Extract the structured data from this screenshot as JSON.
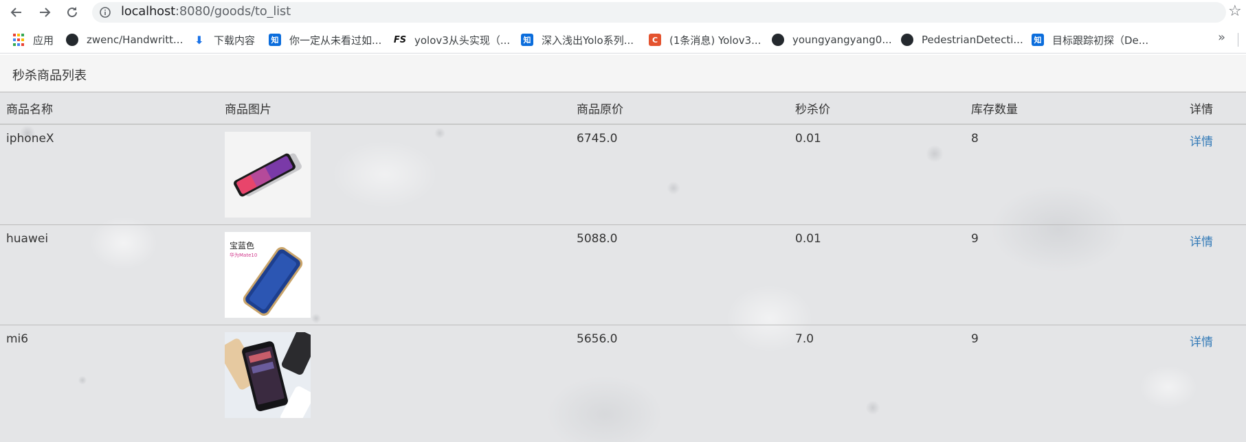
{
  "browser": {
    "url_host": "localhost",
    "url_path": ":8080/goods/to_list",
    "bookmarks": [
      {
        "label": "应用",
        "icon": "apps-grid-icon"
      },
      {
        "label": "zwenc/Handwritt...",
        "icon": "github-icon"
      },
      {
        "label": "下载内容",
        "icon": "download-icon"
      },
      {
        "label": "你一定从未看过如...",
        "icon": "zhihu-icon"
      },
      {
        "label": "yolov3从头实现（...",
        "icon": "fs-icon"
      },
      {
        "label": "深入浅出Yolo系列...",
        "icon": "zhihu-icon"
      },
      {
        "label": "(1条消息) Yolov3...",
        "icon": "csdn-icon"
      },
      {
        "label": "youngyangyang0...",
        "icon": "github-icon"
      },
      {
        "label": "PedestrianDetecti...",
        "icon": "github-icon"
      },
      {
        "label": "目标跟踪初探（De...",
        "icon": "zhihu-icon"
      }
    ],
    "more_label": "»"
  },
  "page": {
    "title": "秒杀商品列表",
    "columns": [
      "商品名称",
      "商品图片",
      "商品原价",
      "秒杀价",
      "库存数量",
      "详情"
    ],
    "rows": [
      {
        "name": "iphoneX",
        "original_price": "6745.0",
        "seckill_price": "0.01",
        "stock": "8",
        "detail": "详情",
        "image_icon": "phone-image-iphonex"
      },
      {
        "name": "huawei",
        "original_price": "5088.0",
        "seckill_price": "0.01",
        "stock": "9",
        "detail": "详情",
        "image_icon": "phone-image-huawei",
        "image_text_1": "宝蓝色",
        "image_text_2": "华为Mate10"
      },
      {
        "name": "mi6",
        "original_price": "5656.0",
        "seckill_price": "7.0",
        "stock": "9",
        "detail": "详情",
        "image_icon": "phone-image-mi6"
      }
    ]
  },
  "colors": {
    "link": "#337ab7",
    "heading_bg": "#f5f5f5",
    "text": "#333333"
  }
}
